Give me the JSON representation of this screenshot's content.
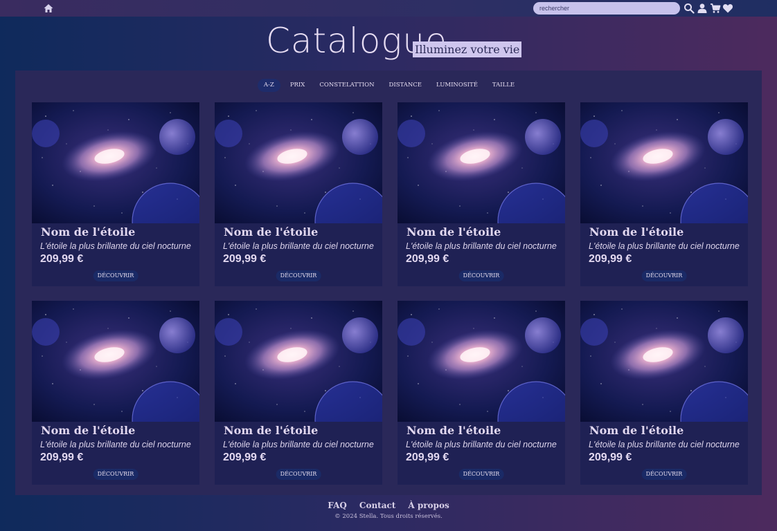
{
  "header": {
    "search_placeholder": "rechercher",
    "icons": [
      "home-icon",
      "search-icon",
      "user-icon",
      "cart-icon",
      "heart-icon"
    ]
  },
  "hero": {
    "title": "Catalogue",
    "subtitle": "Illuminez votre vie"
  },
  "filters": [
    "A-Z",
    "PRIX",
    "CONSTELATTION",
    "DISTANCE",
    "LUMINOSITÉ",
    "TAILLE"
  ],
  "products": [
    {
      "name": "Nom de l'étoile",
      "description": "L'étoile la plus brillante du ciel nocturne",
      "price": "209,99 €",
      "button": "DÉCOUVRIR"
    },
    {
      "name": "Nom de l'étoile",
      "description": "L'étoile la plus brillante du ciel nocturne",
      "price": "209,99 €",
      "button": "DÉCOUVRIR"
    },
    {
      "name": "Nom de l'étoile",
      "description": "L'étoile la plus brillante du ciel nocturne",
      "price": "209,99 €",
      "button": "DÉCOUVRIR"
    },
    {
      "name": "Nom de l'étoile",
      "description": "L'étoile la plus brillante du ciel nocturne",
      "price": "209,99 €",
      "button": "DÉCOUVRIR"
    },
    {
      "name": "Nom de l'étoile",
      "description": "L'étoile la plus brillante du ciel nocturne",
      "price": "209,99 €",
      "button": "DÉCOUVRIR"
    },
    {
      "name": "Nom de l'étoile",
      "description": "L'étoile la plus brillante du ciel nocturne",
      "price": "209,99 €",
      "button": "DÉCOUVRIR"
    },
    {
      "name": "Nom de l'étoile",
      "description": "L'étoile la plus brillante du ciel nocturne",
      "price": "209,99 €",
      "button": "DÉCOUVRIR"
    },
    {
      "name": "Nom de l'étoile",
      "description": "L'étoile la plus brillante du ciel nocturne",
      "price": "209,99 €",
      "button": "DÉCOUVRIR"
    }
  ],
  "footer": {
    "links": [
      "FAQ",
      "Contact",
      "À propos"
    ],
    "copyright": "© 2024 Stella. Tous droits réservés."
  },
  "colors": {
    "accent": "#1e2c6b",
    "panel": "#2a2859",
    "card": "#1f2154",
    "search_bg": "#c7c2ec"
  }
}
